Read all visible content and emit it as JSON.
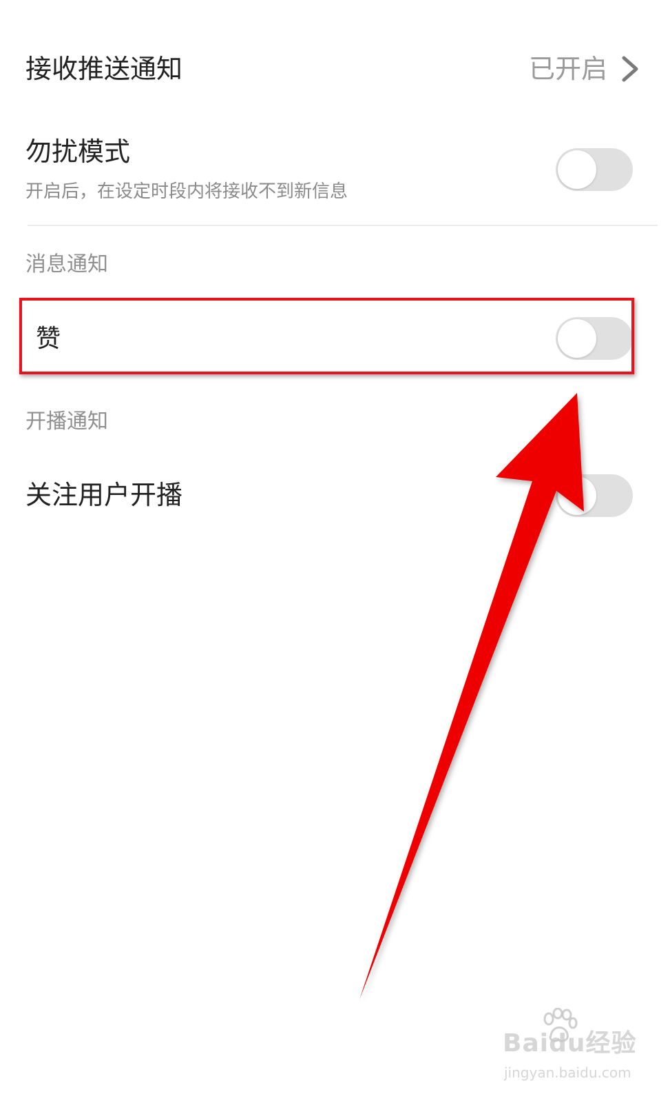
{
  "settings": {
    "push": {
      "title": "接收推送通知",
      "status": "已开启"
    },
    "dnd": {
      "title": "勿扰模式",
      "description": "开启后，在设定时段内将接收不到新信息",
      "enabled": false
    },
    "message_section": {
      "header": "消息通知",
      "like": {
        "title": "赞",
        "enabled": false
      }
    },
    "live_section": {
      "header": "开播通知",
      "followed": {
        "title": "关注用户开播",
        "enabled": false
      }
    }
  },
  "annotation": {
    "color": "#e8131c",
    "highlight_target": "赞"
  },
  "watermark": {
    "brand": "Baidu经验",
    "url": "jingyan.baidu.com"
  },
  "icons": {
    "chevron": "chevron-right-icon",
    "paw": "baidu-paw-icon"
  }
}
